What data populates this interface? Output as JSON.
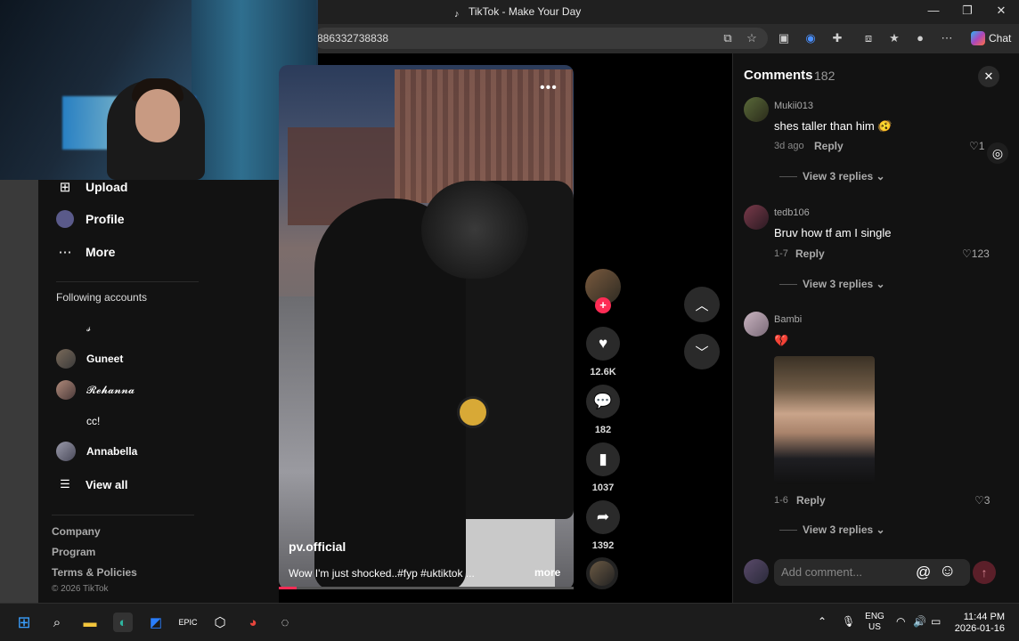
{
  "browser": {
    "tab_title": "TikTok - Make Your Day",
    "url": "886332738838",
    "chat_label": "Chat"
  },
  "sidebar": {
    "nav": [
      {
        "label": "Upload",
        "icon": "upload-icon"
      },
      {
        "label": "Profile",
        "icon": "profile-icon"
      },
      {
        "label": "More",
        "icon": "more-icon"
      }
    ],
    "following_title": "Following accounts",
    "accounts": [
      {
        "name": "𝓈"
      },
      {
        "name": "Guneet"
      },
      {
        "name": "𝓡𝓮𝓱𝓪𝓷𝓷𝓪"
      },
      {
        "name": "cc!"
      },
      {
        "name": "Annabella"
      }
    ],
    "view_all": "View all",
    "footer": {
      "company": "Company",
      "program": "Program",
      "terms": "Terms & Policies",
      "copyright": "© 2026 TikTok"
    }
  },
  "video": {
    "author": "pv.official",
    "caption": "Wow I'm just shocked..#fyp #uktiktok ...",
    "more_label": "more",
    "likes": "12.6K",
    "comments": "182",
    "saves": "1037",
    "shares": "1392",
    "progress": 0.06
  },
  "comments": {
    "title": "Comments",
    "count": "182",
    "items": [
      {
        "user": "Mukii013",
        "text": "shes taller than him 🫨",
        "date": "3d ago",
        "reply": "Reply",
        "likes": "1",
        "view_replies": "View 3 replies"
      },
      {
        "user": "tedb106",
        "text": "Bruv how tf am I single",
        "date": "1-7",
        "reply": "Reply",
        "likes": "123",
        "view_replies": "View 3 replies"
      },
      {
        "user": "Bambi",
        "text": "💔",
        "date": "1-6",
        "reply": "Reply",
        "likes": "3",
        "view_replies": "View 3 replies"
      }
    ],
    "add_placeholder": "Add comment..."
  },
  "taskbar": {
    "lang_top": "ENG",
    "lang_bottom": "US",
    "time": "11:44 PM",
    "date": "2026-01-16"
  }
}
